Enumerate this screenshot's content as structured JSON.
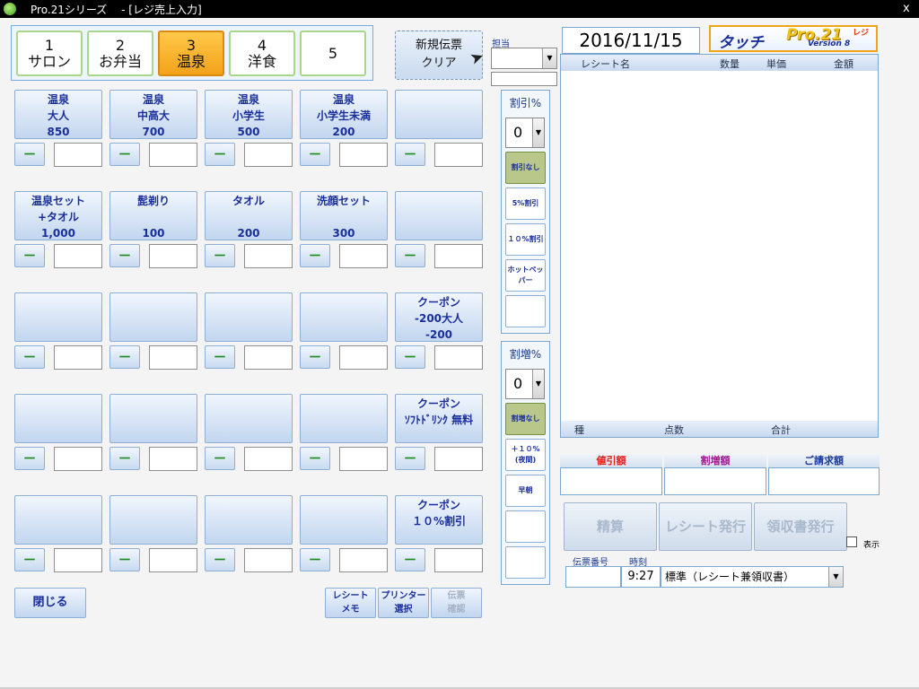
{
  "window": {
    "title": "Pro.21シリーズ　 - [レジ売上入力]",
    "close_glyph": "x"
  },
  "categories": [
    {
      "num": "1",
      "name": "サロン"
    },
    {
      "num": "2",
      "name": "お弁当"
    },
    {
      "num": "3",
      "name": "温泉",
      "selected": true
    },
    {
      "num": "4",
      "name": "洋食"
    },
    {
      "num": "5",
      "name": ""
    }
  ],
  "new_slip": {
    "line1": "新規伝票",
    "line2": "クリア"
  },
  "products": [
    [
      "温泉",
      "大人",
      "850"
    ],
    [
      "温泉",
      "中高大",
      "700"
    ],
    [
      "温泉",
      "小学生",
      "500"
    ],
    [
      "温泉",
      "小学生未満",
      "200"
    ],
    [
      "",
      "",
      ""
    ],
    [
      "温泉セット",
      "+タオル",
      "1,000"
    ],
    [
      "髭剃り",
      "",
      "100"
    ],
    [
      "タオル",
      "",
      "200"
    ],
    [
      "洗顔セット",
      "",
      "300"
    ],
    [
      "",
      "",
      ""
    ],
    [
      "",
      "",
      ""
    ],
    [
      "",
      "",
      ""
    ],
    [
      "",
      "",
      ""
    ],
    [
      "",
      "",
      ""
    ],
    [
      "クーポン",
      "-200大人",
      "-200"
    ],
    [
      "",
      "",
      ""
    ],
    [
      "",
      "",
      ""
    ],
    [
      "",
      "",
      ""
    ],
    [
      "",
      "",
      ""
    ],
    [
      "クーポン",
      "ｿﾌﾄﾄﾞﾘﾝｸ 無料",
      ""
    ],
    [
      "",
      "",
      ""
    ],
    [
      "",
      "",
      ""
    ],
    [
      "",
      "",
      ""
    ],
    [
      "",
      "",
      ""
    ],
    [
      "クーポン",
      "１０%割引",
      ""
    ]
  ],
  "minus_label": "－",
  "bottom": {
    "close": "閉じる",
    "receipt_memo": [
      "レシート",
      "メモ"
    ],
    "printer_select": [
      "プリンター",
      "選択"
    ],
    "slip_confirm": [
      "伝票",
      "確認"
    ]
  },
  "staff": {
    "label": "担当"
  },
  "discount": {
    "label": "割引%",
    "value": "0",
    "options": [
      "割引なし",
      "5%割引",
      "１０%割引",
      "ホットペッパー",
      ""
    ]
  },
  "surcharge": {
    "label": "割増%",
    "value": "0",
    "options": [
      "割増なし",
      "＋１０%(夜間)",
      "早朝",
      "",
      ""
    ]
  },
  "date": "2016/11/15",
  "logo": {
    "touch": "タッチ",
    "pro": "Pro.21",
    "reji": "レジ",
    "version": "Version 8"
  },
  "receipt": {
    "headers": [
      "レシート名",
      "数量",
      "単価",
      "金額"
    ],
    "footer": [
      "種",
      "点数",
      "合計"
    ]
  },
  "totals": {
    "discount_amount": "値引額",
    "surcharge_amount": "割増額",
    "billing_amount": "ご請求額",
    "colors": {
      "discount": "#e0201a",
      "surcharge": "#a01890",
      "billing": "#1a3a9a"
    }
  },
  "actions": {
    "settle": "精算",
    "receipt_issue": "レシート発行",
    "receipt_book": "領収書発行"
  },
  "show_label": "表示",
  "slip": {
    "number_label": "伝票番号",
    "time_label": "時刻",
    "time": "9:27",
    "type": "標準（レシート兼領収書）"
  },
  "dropdown_glyph": "▼"
}
